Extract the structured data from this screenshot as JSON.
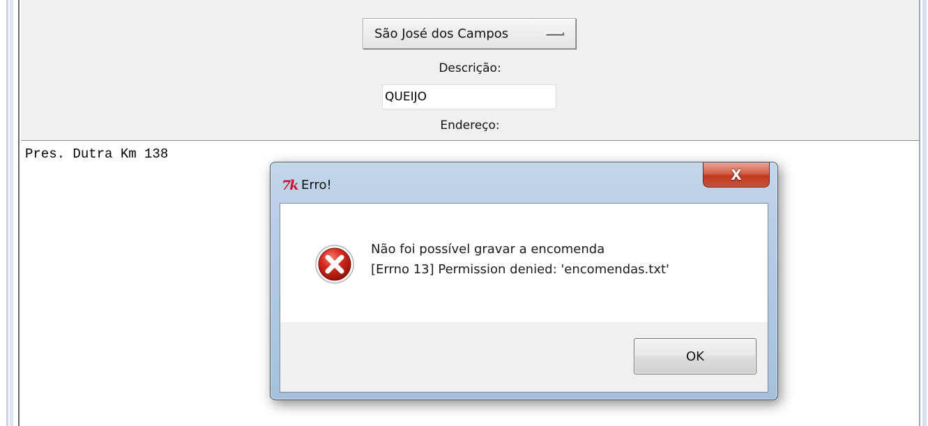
{
  "form": {
    "city_value": "São José dos Campos",
    "description_label": "Descrição:",
    "description_value": "QUEIJO",
    "address_label": "Endereço:"
  },
  "address_text": {
    "content": "Pres. Dutra Km 138"
  },
  "dialog": {
    "title": "Erro!",
    "app_icon_text": "7k",
    "close_label": "X",
    "message_line1": "Não foi possível gravar a encomenda",
    "message_line2": "[Errno 13] Permission denied: 'encomendas.txt'",
    "ok_label": "OK",
    "icon": "error-icon"
  }
}
